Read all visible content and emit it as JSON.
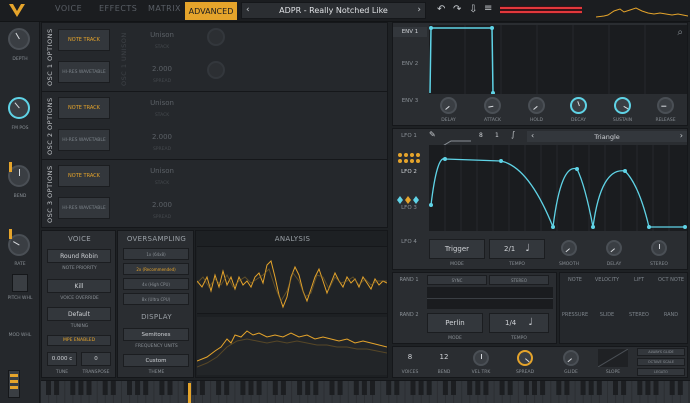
{
  "header": {
    "tabs": [
      "VOICE",
      "EFFECTS",
      "MATRIX",
      "ADVANCED"
    ],
    "active_tab": "ADVANCED",
    "preset_name": "ADPR - Really Notched Like"
  },
  "left_strip": {
    "depth": "DEPTH",
    "fm_pos": "FM POS",
    "bend": "BEND",
    "rate": "RATE",
    "pitch_whl": "PITCH WHL",
    "mod_whl": "MOD WHL"
  },
  "osc": {
    "titles": [
      "OSC 1 OPTIONS",
      "OSC 2 OPTIONS",
      "OSC 3 OPTIONS"
    ],
    "note_track": "NOTE TRACK",
    "hi_res": "HI-RES WAVETABLE",
    "unison_dim": "OSC 1 UNISON",
    "stack": "Unison",
    "stack_label": "STACK",
    "spread_val": "2.000",
    "spread_label": "SPREAD"
  },
  "voice": {
    "title": "VOICE",
    "note_priority": "Round Robin",
    "note_priority_label": "NOTE PRIORITY",
    "voice_override": "Kill",
    "voice_override_label": "VOICE OVERRIDE",
    "tuning": "Default",
    "tuning_label": "TUNING",
    "mpe": "MPE ENABLED",
    "tune_val": "0.000 c",
    "tune_label": "TUNE",
    "transpose_val": "0",
    "transpose_label": "TRANSPOSE"
  },
  "oversampling": {
    "title": "OVERSAMPLING",
    "options": [
      "1x (64x8)",
      "2x (Recommended)",
      "4x (High CPU)",
      "8x (Ultra CPU)"
    ]
  },
  "display": {
    "title": "DISPLAY",
    "semitones": "Semitones",
    "freq_units": "FREQUENCY UNITS",
    "custom": "Custom",
    "theme": "THEME"
  },
  "analysis": {
    "title": "ANALYSIS"
  },
  "env": {
    "labels": [
      "ENV 1",
      "ENV 2",
      "ENV 3"
    ],
    "knobs": [
      "DELAY",
      "ATTACK",
      "HOLD",
      "DECAY",
      "SUSTAIN",
      "RELEASE"
    ]
  },
  "lfo": {
    "labels": [
      "LFO 1",
      "LFO 2",
      "LFO 3",
      "LFO 4"
    ],
    "shape": "Triangle",
    "frequency": "8",
    "beats": "1",
    "mode": "Trigger",
    "mode_label": "MODE",
    "tempo": "2/1",
    "tempo_label": "TEMPO",
    "knobs": [
      "SMOOTH",
      "DELAY",
      "STEREO"
    ]
  },
  "random": {
    "band1": "RAND 1",
    "band2": "RAND 2",
    "sync": "SYNC",
    "stereo": "STEREO",
    "mode": "Perlin",
    "mode_label": "MODE",
    "tempo": "1/4",
    "tempo_label": "TEMPO"
  },
  "mpe_cols": {
    "note": "NOTE",
    "velocity": "VELOCITY",
    "lift": "LIFT",
    "oct_note": "OCT NOTE",
    "pressure": "PRESSURE",
    "slide": "SLIDE",
    "stereo": "STEREO",
    "rand": "RAND"
  },
  "bottom": {
    "voices": "8",
    "voices_label": "VOICES",
    "bend": "12",
    "bend_label": "BEND",
    "vel_trk": "VEL TRK",
    "spread": "SPREAD",
    "glide": "GLIDE",
    "slope": "SLOPE",
    "always_glide": "ALWAYS GLIDE",
    "octave_scale": "OCTAVE SCALE",
    "legato": "LEGATO"
  }
}
